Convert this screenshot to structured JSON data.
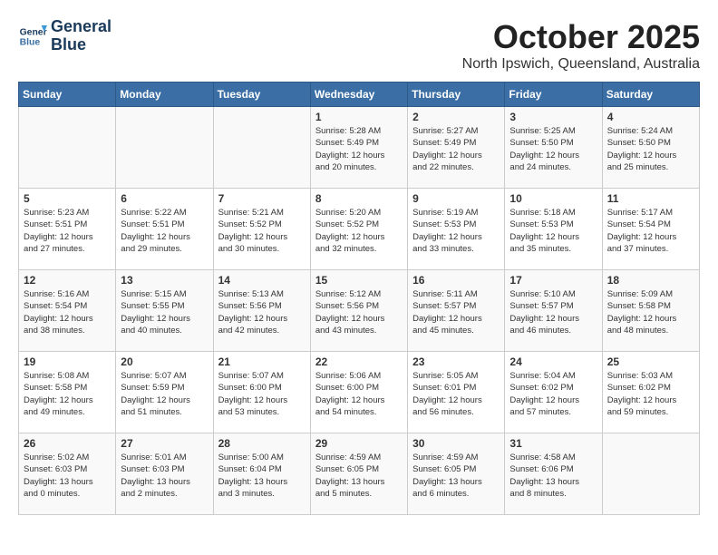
{
  "logo": {
    "line1": "General",
    "line2": "Blue"
  },
  "title": "October 2025",
  "location": "North Ipswich, Queensland, Australia",
  "days_of_week": [
    "Sunday",
    "Monday",
    "Tuesday",
    "Wednesday",
    "Thursday",
    "Friday",
    "Saturday"
  ],
  "weeks": [
    [
      {
        "day": "",
        "info": ""
      },
      {
        "day": "",
        "info": ""
      },
      {
        "day": "",
        "info": ""
      },
      {
        "day": "1",
        "info": "Sunrise: 5:28 AM\nSunset: 5:49 PM\nDaylight: 12 hours\nand 20 minutes."
      },
      {
        "day": "2",
        "info": "Sunrise: 5:27 AM\nSunset: 5:49 PM\nDaylight: 12 hours\nand 22 minutes."
      },
      {
        "day": "3",
        "info": "Sunrise: 5:25 AM\nSunset: 5:50 PM\nDaylight: 12 hours\nand 24 minutes."
      },
      {
        "day": "4",
        "info": "Sunrise: 5:24 AM\nSunset: 5:50 PM\nDaylight: 12 hours\nand 25 minutes."
      }
    ],
    [
      {
        "day": "5",
        "info": "Sunrise: 5:23 AM\nSunset: 5:51 PM\nDaylight: 12 hours\nand 27 minutes."
      },
      {
        "day": "6",
        "info": "Sunrise: 5:22 AM\nSunset: 5:51 PM\nDaylight: 12 hours\nand 29 minutes."
      },
      {
        "day": "7",
        "info": "Sunrise: 5:21 AM\nSunset: 5:52 PM\nDaylight: 12 hours\nand 30 minutes."
      },
      {
        "day": "8",
        "info": "Sunrise: 5:20 AM\nSunset: 5:52 PM\nDaylight: 12 hours\nand 32 minutes."
      },
      {
        "day": "9",
        "info": "Sunrise: 5:19 AM\nSunset: 5:53 PM\nDaylight: 12 hours\nand 33 minutes."
      },
      {
        "day": "10",
        "info": "Sunrise: 5:18 AM\nSunset: 5:53 PM\nDaylight: 12 hours\nand 35 minutes."
      },
      {
        "day": "11",
        "info": "Sunrise: 5:17 AM\nSunset: 5:54 PM\nDaylight: 12 hours\nand 37 minutes."
      }
    ],
    [
      {
        "day": "12",
        "info": "Sunrise: 5:16 AM\nSunset: 5:54 PM\nDaylight: 12 hours\nand 38 minutes."
      },
      {
        "day": "13",
        "info": "Sunrise: 5:15 AM\nSunset: 5:55 PM\nDaylight: 12 hours\nand 40 minutes."
      },
      {
        "day": "14",
        "info": "Sunrise: 5:13 AM\nSunset: 5:56 PM\nDaylight: 12 hours\nand 42 minutes."
      },
      {
        "day": "15",
        "info": "Sunrise: 5:12 AM\nSunset: 5:56 PM\nDaylight: 12 hours\nand 43 minutes."
      },
      {
        "day": "16",
        "info": "Sunrise: 5:11 AM\nSunset: 5:57 PM\nDaylight: 12 hours\nand 45 minutes."
      },
      {
        "day": "17",
        "info": "Sunrise: 5:10 AM\nSunset: 5:57 PM\nDaylight: 12 hours\nand 46 minutes."
      },
      {
        "day": "18",
        "info": "Sunrise: 5:09 AM\nSunset: 5:58 PM\nDaylight: 12 hours\nand 48 minutes."
      }
    ],
    [
      {
        "day": "19",
        "info": "Sunrise: 5:08 AM\nSunset: 5:58 PM\nDaylight: 12 hours\nand 49 minutes."
      },
      {
        "day": "20",
        "info": "Sunrise: 5:07 AM\nSunset: 5:59 PM\nDaylight: 12 hours\nand 51 minutes."
      },
      {
        "day": "21",
        "info": "Sunrise: 5:07 AM\nSunset: 6:00 PM\nDaylight: 12 hours\nand 53 minutes."
      },
      {
        "day": "22",
        "info": "Sunrise: 5:06 AM\nSunset: 6:00 PM\nDaylight: 12 hours\nand 54 minutes."
      },
      {
        "day": "23",
        "info": "Sunrise: 5:05 AM\nSunset: 6:01 PM\nDaylight: 12 hours\nand 56 minutes."
      },
      {
        "day": "24",
        "info": "Sunrise: 5:04 AM\nSunset: 6:02 PM\nDaylight: 12 hours\nand 57 minutes."
      },
      {
        "day": "25",
        "info": "Sunrise: 5:03 AM\nSunset: 6:02 PM\nDaylight: 12 hours\nand 59 minutes."
      }
    ],
    [
      {
        "day": "26",
        "info": "Sunrise: 5:02 AM\nSunset: 6:03 PM\nDaylight: 13 hours\nand 0 minutes."
      },
      {
        "day": "27",
        "info": "Sunrise: 5:01 AM\nSunset: 6:03 PM\nDaylight: 13 hours\nand 2 minutes."
      },
      {
        "day": "28",
        "info": "Sunrise: 5:00 AM\nSunset: 6:04 PM\nDaylight: 13 hours\nand 3 minutes."
      },
      {
        "day": "29",
        "info": "Sunrise: 4:59 AM\nSunset: 6:05 PM\nDaylight: 13 hours\nand 5 minutes."
      },
      {
        "day": "30",
        "info": "Sunrise: 4:59 AM\nSunset: 6:05 PM\nDaylight: 13 hours\nand 6 minutes."
      },
      {
        "day": "31",
        "info": "Sunrise: 4:58 AM\nSunset: 6:06 PM\nDaylight: 13 hours\nand 8 minutes."
      },
      {
        "day": "",
        "info": ""
      }
    ]
  ]
}
